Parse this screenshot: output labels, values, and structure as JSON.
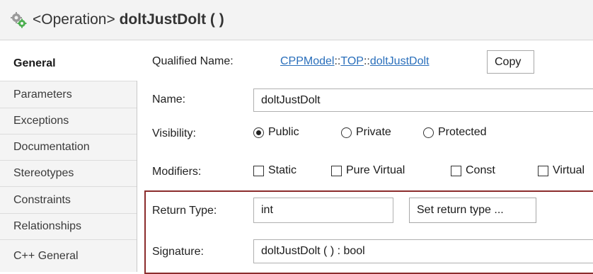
{
  "header": {
    "icon": "gear-icon",
    "type_prefix": "<Operation>",
    "name": "doltJustDolt ( )"
  },
  "tabs": [
    {
      "label": "General",
      "active": true
    },
    {
      "label": "Parameters"
    },
    {
      "label": "Exceptions"
    },
    {
      "label": "Documentation"
    },
    {
      "label": "Stereotypes"
    },
    {
      "label": "Constraints"
    },
    {
      "label": "Relationships"
    },
    {
      "label": "C++ General"
    }
  ],
  "qualified_name": {
    "label": "Qualified Name:",
    "parts": [
      "CPPModel",
      "TOP",
      "doltJustDolt"
    ],
    "separator": "::",
    "copy_label": "Copy"
  },
  "name": {
    "label": "Name:",
    "value": "doltJustDolt"
  },
  "visibility": {
    "label": "Visibility:",
    "options": [
      "Public",
      "Private",
      "Protected"
    ],
    "selected": "Public"
  },
  "modifiers": {
    "label": "Modifiers:",
    "options": [
      "Static",
      "Pure Virtual",
      "Const",
      "Virtual"
    ]
  },
  "return_type": {
    "label": "Return Type:",
    "value": "int",
    "button_label": "Set return type ..."
  },
  "signature": {
    "label": "Signature:",
    "value": "doltJustDolt ( ) : bool"
  },
  "colors": {
    "highlight_border": "#8b2c2c",
    "link": "#2a6fbb"
  }
}
